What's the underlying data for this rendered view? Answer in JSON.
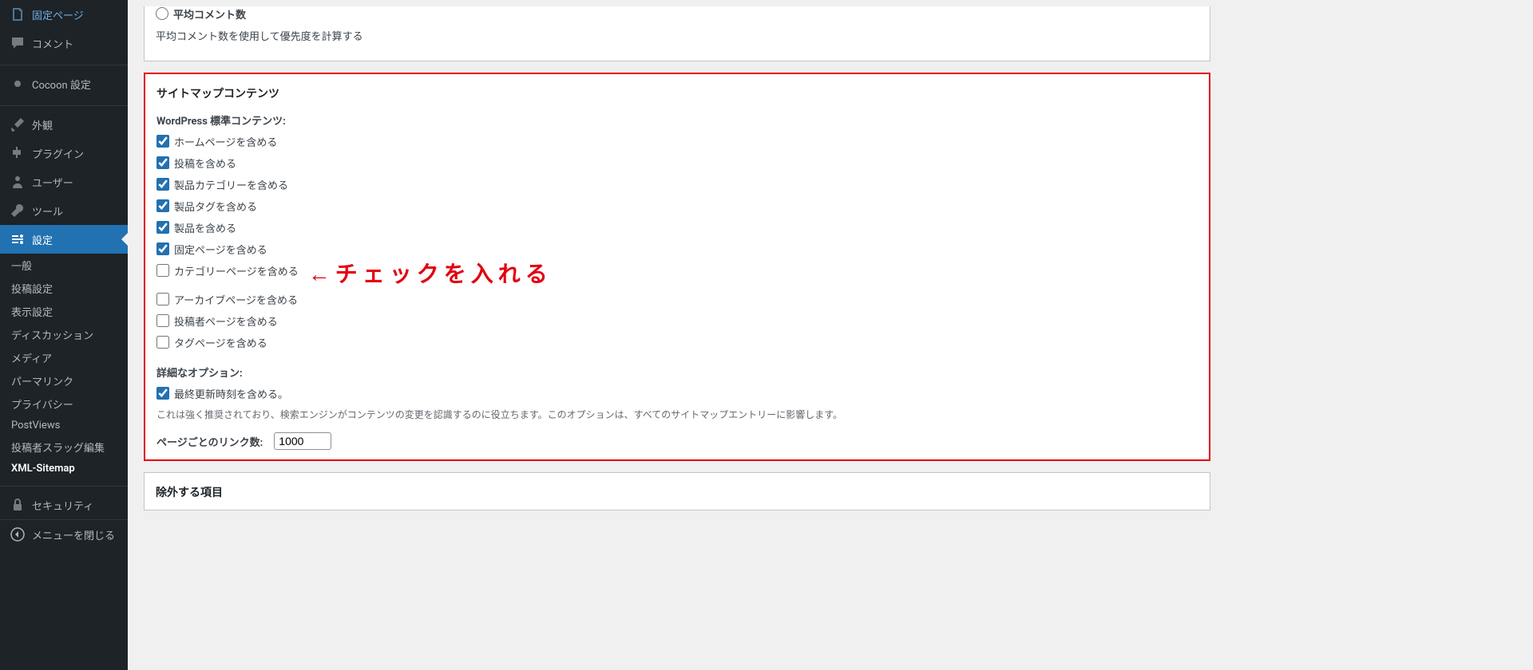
{
  "sidebar": {
    "items": [
      {
        "icon": "page",
        "label": "固定ページ"
      },
      {
        "icon": "comment",
        "label": "コメント"
      },
      {
        "icon": "dot",
        "label": "Cocoon 設定"
      },
      {
        "icon": "brush",
        "label": "外観"
      },
      {
        "icon": "plugin",
        "label": "プラグイン"
      },
      {
        "icon": "user",
        "label": "ユーザー"
      },
      {
        "icon": "wrench",
        "label": "ツール"
      },
      {
        "icon": "settings",
        "label": "設定"
      }
    ],
    "sub": [
      "一般",
      "投稿設定",
      "表示設定",
      "ディスカッション",
      "メディア",
      "パーマリンク",
      "プライバシー",
      "PostViews",
      "投稿者スラッグ編集",
      "XML-Sitemap"
    ],
    "security": "セキュリティ",
    "collapse": "メニューを閉じる"
  },
  "top_panel": {
    "radio_label": "平均コメント数",
    "radio_desc": "平均コメント数を使用して優先度を計算する"
  },
  "content_panel": {
    "title": "サイトマップコンテンツ",
    "standard_heading": "WordPress 標準コンテンツ:",
    "checkboxes": [
      {
        "label": "ホームページを含める",
        "checked": true
      },
      {
        "label": "投稿を含める",
        "checked": true
      },
      {
        "label": "製品カテゴリーを含める",
        "checked": true
      },
      {
        "label": "製品タグを含める",
        "checked": true
      },
      {
        "label": "製品を含める",
        "checked": true
      },
      {
        "label": "固定ページを含める",
        "checked": true
      },
      {
        "label": "カテゴリーページを含める",
        "checked": false
      },
      {
        "label": "アーカイブページを含める",
        "checked": false
      },
      {
        "label": "投稿者ページを含める",
        "checked": false
      },
      {
        "label": "タグページを含める",
        "checked": false
      }
    ],
    "annotation": "←チェックを入れる",
    "advanced_heading": "詳細なオプション:",
    "lastmod_label": "最終更新時刻を含める。",
    "lastmod_note": "これは強く推奨されており、検索エンジンがコンテンツの変更を認識するのに役立ちます。このオプションは、すべてのサイトマップエントリーに影響します。",
    "linkcount_label": "ページごとのリンク数:",
    "linkcount_value": 1000
  },
  "exclude_panel": {
    "title": "除外する項目"
  }
}
